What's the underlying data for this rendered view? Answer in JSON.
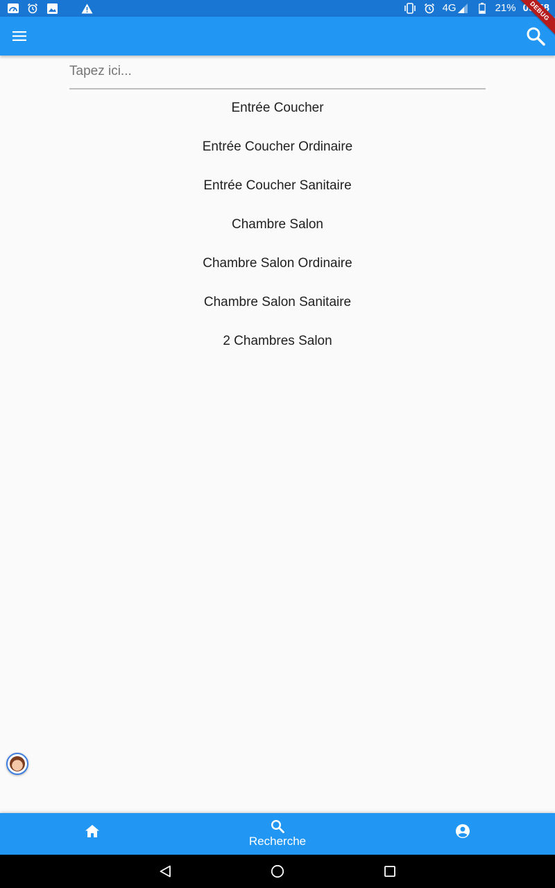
{
  "status_bar": {
    "battery_percent": "21%",
    "network": "4G",
    "time": "05:58",
    "icons": [
      "speedometer-icon",
      "alarm-icon",
      "image-icon",
      "warning-icon",
      "vibrate-icon",
      "alarm-icon",
      "signal-icon",
      "battery-icon"
    ]
  },
  "debug_banner": "DEBUG",
  "app_bar": {
    "menu_icon": "hamburger-menu-icon",
    "search_icon": "search-icon"
  },
  "search": {
    "placeholder": "Tapez ici...",
    "value": ""
  },
  "results": [
    "Entrée Coucher",
    "Entrée Coucher Ordinaire",
    "Entrée Coucher Sanitaire",
    "Chambre Salon",
    "Chambre Salon Ordinaire",
    "Chambre Salon Sanitaire",
    "2 Chambres Salon"
  ],
  "bottom_nav": {
    "items": [
      {
        "icon": "home-icon",
        "label": ""
      },
      {
        "icon": "search-icon",
        "label": "Recherche",
        "selected": true
      },
      {
        "icon": "account-circle-icon",
        "label": ""
      }
    ]
  },
  "system_nav": {
    "icons": [
      "back-icon",
      "home-circle-icon",
      "recents-icon"
    ]
  },
  "colors": {
    "status_bar": "#1976d2",
    "primary": "#2196f3",
    "background": "#fafafa",
    "text": "#212121"
  }
}
